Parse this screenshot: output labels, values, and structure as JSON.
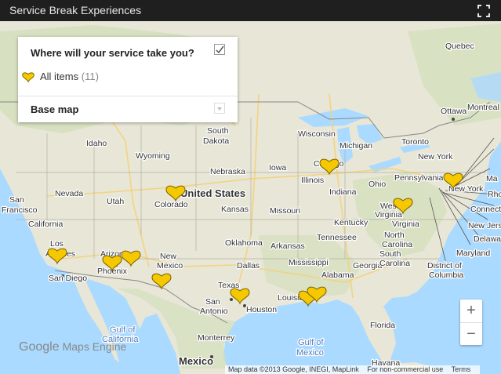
{
  "title": "Service Break Experiences",
  "panel": {
    "heading": "Where will your service take you?",
    "layer_label": "All items",
    "layer_count": "(11)",
    "base_map_label": "Base map"
  },
  "zoom": {
    "in": "+",
    "out": "−"
  },
  "attribution": {
    "mapdata": "Map data ©2013 Google, INEGI, MapLink",
    "use": "For non-commercial use",
    "terms": "Terms"
  },
  "logo": {
    "google": "Google",
    "product": "Maps Engine"
  },
  "colors": {
    "marker": "#f5c800",
    "land": "#e8e4d6",
    "water": "#aadaff",
    "titlebar": "#1f1f1f"
  },
  "map_labels": {
    "united_states": "United States",
    "mexico": "Mexico",
    "gulf_california_1": "Gulf of",
    "gulf_california_2": "California",
    "gulf_mexico_1": "Gulf of",
    "gulf_mexico_2": "Mexico",
    "nevada": "Nevada",
    "utah": "Utah",
    "colorado": "Colorado",
    "arizona": "Arizona",
    "new_mexico_1": "New",
    "new_mexico_2": "Mexico",
    "wyoming": "Wyoming",
    "idaho": "Idaho",
    "south_dakota_1": "South",
    "south_dakota_2": "Dakota",
    "nebraska": "Nebraska",
    "kansas": "Kansas",
    "oklahoma": "Oklahoma",
    "texas": "Texas",
    "iowa": "Iowa",
    "missouri": "Missouri",
    "illinois": "Illinois",
    "indiana": "Indiana",
    "kentucky": "Kentucky",
    "tennessee": "Tennessee",
    "mississippi": "Mississippi",
    "alabama": "Alabama",
    "georgia": "Georgia",
    "louisiana": "Louisiana",
    "arkansas": "Arkansas",
    "wisconsin": "Wisconsin",
    "michigan": "Michigan",
    "ohio": "Ohio",
    "pennsylvania": "Pennsylvania",
    "new_york_state": "New York",
    "west_virginia_1": "West",
    "west_virginia_2": "Virginia",
    "virginia": "Virginia",
    "north_carolina_1": "North",
    "north_carolina_2": "Carolina",
    "south_carolina_1": "South",
    "south_carolina_2": "Carolina",
    "florida": "Florida",
    "california": "California",
    "san_francisco_1": "San",
    "san_francisco_2": "Francisco",
    "los_angeles_1": "Los",
    "los_angeles_2": "Angeles",
    "san_diego": "San Diego",
    "phoenix": "Phoenix",
    "dallas": "Dallas",
    "san_antonio_1": "San",
    "san_antonio_2": "Antonio",
    "houston": "Houston",
    "chicago": "Chicago",
    "toronto": "Toronto",
    "ottawa": "Ottawa",
    "montreal": "Montreal",
    "quebec": "Quebec",
    "new_york_city": "New York",
    "monterrey": "Monterrey",
    "maryland": "Maryland",
    "district_columbia_1": "District of",
    "district_columbia_2": "Columbia",
    "delaware": "Delaware",
    "new_jersey": "New Jersey",
    "connecticut": "Connect",
    "rhode_island": "Rho",
    "massachusetts": "Ma",
    "havana": "Havana"
  },
  "markers": [
    {
      "name": "Los Angeles"
    },
    {
      "name": "Phoenix"
    },
    {
      "name": "Arizona"
    },
    {
      "name": "New Mexico"
    },
    {
      "name": "Colorado"
    },
    {
      "name": "San Antonio"
    },
    {
      "name": "Louisiana 1"
    },
    {
      "name": "Louisiana 2"
    },
    {
      "name": "Chicago"
    },
    {
      "name": "West Virginia"
    },
    {
      "name": "New York"
    }
  ]
}
